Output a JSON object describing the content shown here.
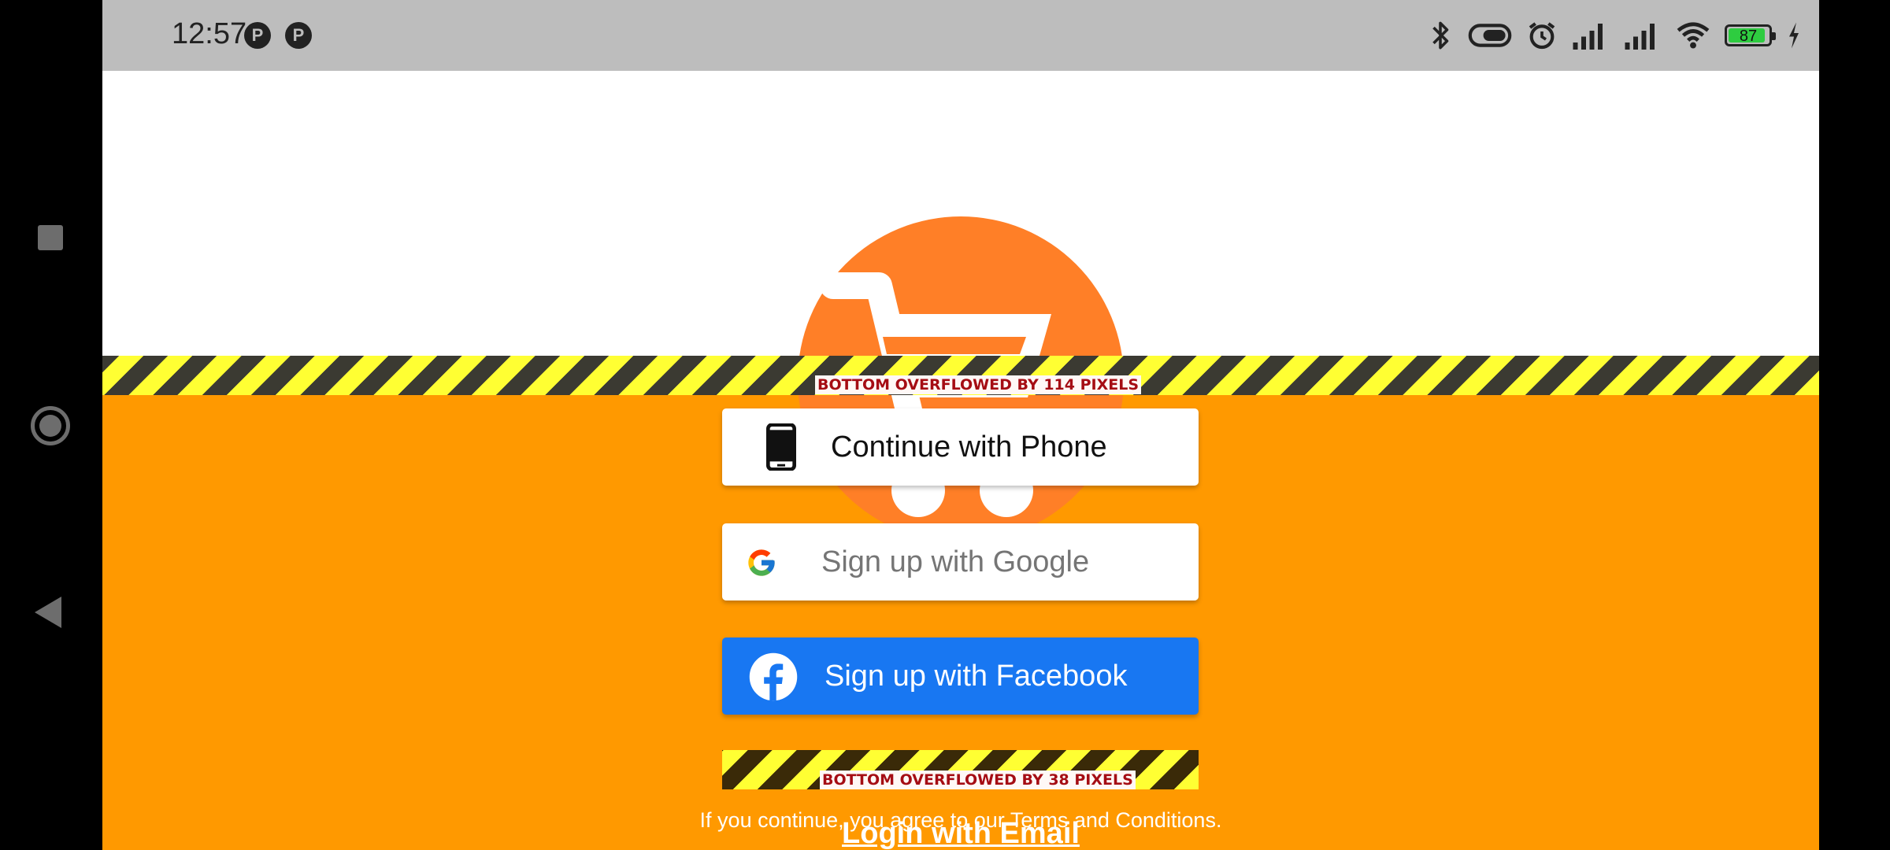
{
  "status_bar": {
    "time": "12:57",
    "notification_icons": [
      "app-notification-icon",
      "app-notification-icon"
    ],
    "system_icons": [
      "bluetooth-icon",
      "toggle-icon",
      "alarm-icon",
      "signal-icon",
      "signal-icon",
      "wifi-icon"
    ],
    "battery_level": "87",
    "charging": true
  },
  "logo": {
    "icon": "shopping-cart-icon",
    "color": "#ff7f27"
  },
  "debug": {
    "overflow_top": "BOTTOM OVERFLOWED BY 114 PIXELS",
    "overflow_bottom": "BOTTOM OVERFLOWED BY 38 PIXELS"
  },
  "auth": {
    "phone_label": "Continue with Phone",
    "google_label": "Sign up with Google",
    "facebook_label": "Sign up with Facebook",
    "terms": "If you continue, you agree to our Terms and Conditions.",
    "login_email": "Login with Email"
  },
  "colors": {
    "background": "#ff9900",
    "facebook": "#1877f2",
    "status_bar": "#bdbdbd"
  },
  "nav_bar": {
    "items": [
      "recents-icon",
      "home-icon",
      "back-icon"
    ]
  }
}
